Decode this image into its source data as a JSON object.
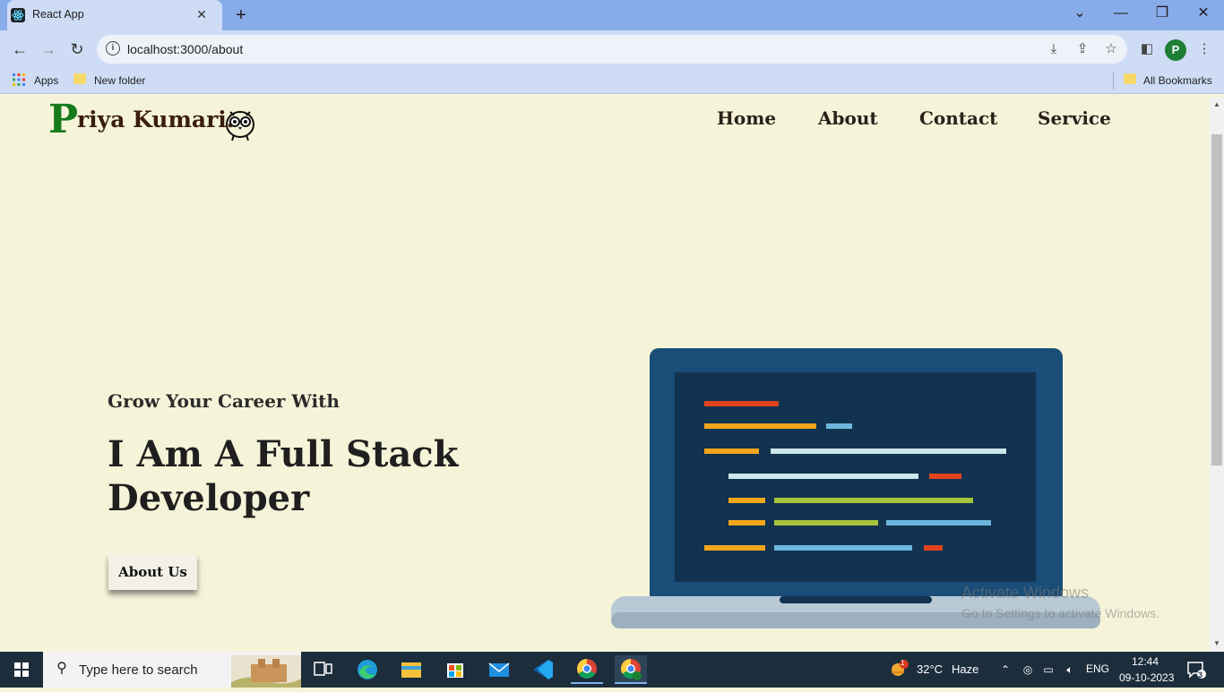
{
  "browser": {
    "tab": {
      "title": "React App"
    },
    "address": {
      "url": "localhost:3000/about"
    },
    "profile_initial": "P",
    "bookmarks": {
      "apps_label": "Apps",
      "folder_label": "New folder",
      "all_label": "All Bookmarks"
    }
  },
  "page": {
    "logo": {
      "initial": "P",
      "rest": "riya Kumari."
    },
    "nav": [
      "Home",
      "About",
      "Contact",
      "Service"
    ],
    "hero": {
      "subtitle": "Grow Your Career With",
      "title": "I Am A Full Stack Developer",
      "button": "About Us"
    }
  },
  "watermark": {
    "line1": "Activate Windows",
    "line2": "Go to Settings to activate Windows."
  },
  "taskbar": {
    "search_placeholder": "Type here to search",
    "weather": {
      "temp": "32°C",
      "condition": "Haze",
      "badge": "1"
    },
    "language": "ENG",
    "time": "12:44",
    "date": "09-10-2023",
    "notification_count": "3"
  },
  "colors": {
    "page_bg": "#f5f4d9",
    "logo_green": "#167a1c",
    "tab_strip": "#88acea",
    "toolbar": "#cfdcf5",
    "taskbar": "#1c2d3c"
  }
}
